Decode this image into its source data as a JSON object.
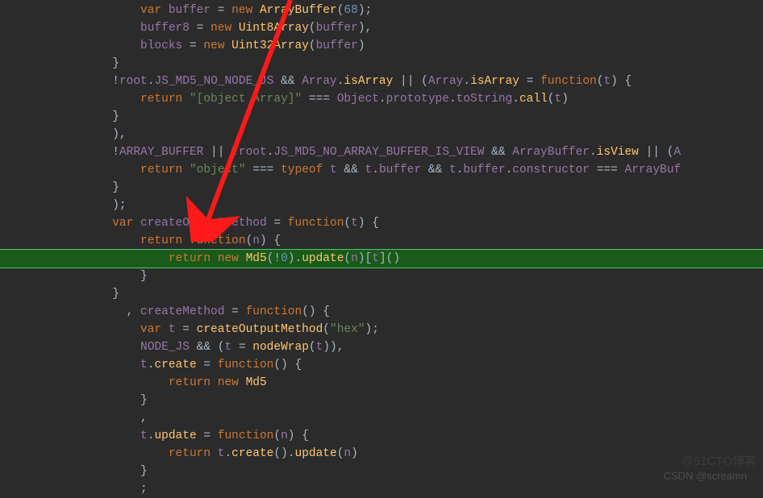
{
  "lines": [
    {
      "indent": "                    ",
      "segs": [
        {
          "c": "kw",
          "t": "var"
        },
        {
          "c": "pl",
          "t": " "
        },
        {
          "c": "id",
          "t": "buffer"
        },
        {
          "c": "pl",
          "t": " = "
        },
        {
          "c": "kw",
          "t": "new"
        },
        {
          "c": "pl",
          "t": " "
        },
        {
          "c": "fn",
          "t": "ArrayBuffer"
        },
        {
          "c": "pl",
          "t": "("
        },
        {
          "c": "num",
          "t": "68"
        },
        {
          "c": "pl",
          "t": ");"
        }
      ],
      "hl": false
    },
    {
      "indent": "                    ",
      "segs": [
        {
          "c": "id",
          "t": "buffer8"
        },
        {
          "c": "pl",
          "t": " = "
        },
        {
          "c": "kw",
          "t": "new"
        },
        {
          "c": "pl",
          "t": " "
        },
        {
          "c": "fn",
          "t": "Uint8Array"
        },
        {
          "c": "pl",
          "t": "("
        },
        {
          "c": "id",
          "t": "buffer"
        },
        {
          "c": "pl",
          "t": "),"
        }
      ],
      "hl": false
    },
    {
      "indent": "                    ",
      "segs": [
        {
          "c": "id",
          "t": "blocks"
        },
        {
          "c": "pl",
          "t": " = "
        },
        {
          "c": "kw",
          "t": "new"
        },
        {
          "c": "pl",
          "t": " "
        },
        {
          "c": "fn",
          "t": "Uint32Array"
        },
        {
          "c": "pl",
          "t": "("
        },
        {
          "c": "id",
          "t": "buffer"
        },
        {
          "c": "pl",
          "t": ")"
        }
      ],
      "hl": false
    },
    {
      "indent": "                ",
      "segs": [
        {
          "c": "pl",
          "t": "}"
        }
      ],
      "hl": false
    },
    {
      "indent": "                ",
      "segs": [
        {
          "c": "pl",
          "t": "!"
        },
        {
          "c": "id",
          "t": "root"
        },
        {
          "c": "pl",
          "t": "."
        },
        {
          "c": "id",
          "t": "JS_MD5_NO_NODE_JS"
        },
        {
          "c": "pl",
          "t": " && "
        },
        {
          "c": "id",
          "t": "Array"
        },
        {
          "c": "pl",
          "t": "."
        },
        {
          "c": "fn",
          "t": "isArray"
        },
        {
          "c": "pl",
          "t": " || ("
        },
        {
          "c": "id",
          "t": "Array"
        },
        {
          "c": "pl",
          "t": "."
        },
        {
          "c": "fn",
          "t": "isArray"
        },
        {
          "c": "pl",
          "t": " = "
        },
        {
          "c": "kw",
          "t": "function"
        },
        {
          "c": "pl",
          "t": "("
        },
        {
          "c": "id",
          "t": "t"
        },
        {
          "c": "pl",
          "t": ") {"
        }
      ],
      "hl": false
    },
    {
      "indent": "                    ",
      "segs": [
        {
          "c": "kw",
          "t": "return"
        },
        {
          "c": "pl",
          "t": " "
        },
        {
          "c": "str",
          "t": "\"[object Array]\""
        },
        {
          "c": "pl",
          "t": " === "
        },
        {
          "c": "id",
          "t": "Object"
        },
        {
          "c": "pl",
          "t": "."
        },
        {
          "c": "id",
          "t": "prototype"
        },
        {
          "c": "pl",
          "t": "."
        },
        {
          "c": "id",
          "t": "toString"
        },
        {
          "c": "pl",
          "t": "."
        },
        {
          "c": "fn",
          "t": "call"
        },
        {
          "c": "pl",
          "t": "("
        },
        {
          "c": "id",
          "t": "t"
        },
        {
          "c": "pl",
          "t": ")"
        }
      ],
      "hl": false
    },
    {
      "indent": "                ",
      "segs": [
        {
          "c": "pl",
          "t": "}"
        }
      ],
      "hl": false
    },
    {
      "indent": "                ",
      "segs": [
        {
          "c": "pl",
          "t": "),"
        }
      ],
      "hl": false
    },
    {
      "indent": "                ",
      "segs": [
        {
          "c": "pl",
          "t": "!"
        },
        {
          "c": "id",
          "t": "ARRAY_BUFFER"
        },
        {
          "c": "pl",
          "t": " || !"
        },
        {
          "c": "id",
          "t": "root"
        },
        {
          "c": "pl",
          "t": "."
        },
        {
          "c": "id",
          "t": "JS_MD5_NO_ARRAY_BUFFER_IS_VIEW"
        },
        {
          "c": "pl",
          "t": " && "
        },
        {
          "c": "id",
          "t": "ArrayBuffer"
        },
        {
          "c": "pl",
          "t": "."
        },
        {
          "c": "fn",
          "t": "isView"
        },
        {
          "c": "pl",
          "t": " || ("
        },
        {
          "c": "id",
          "t": "A"
        }
      ],
      "hl": false
    },
    {
      "indent": "                    ",
      "segs": [
        {
          "c": "kw",
          "t": "return"
        },
        {
          "c": "pl",
          "t": " "
        },
        {
          "c": "str",
          "t": "\"object\""
        },
        {
          "c": "pl",
          "t": " === "
        },
        {
          "c": "kw",
          "t": "typeof"
        },
        {
          "c": "pl",
          "t": " "
        },
        {
          "c": "id",
          "t": "t"
        },
        {
          "c": "pl",
          "t": " && "
        },
        {
          "c": "id",
          "t": "t"
        },
        {
          "c": "pl",
          "t": "."
        },
        {
          "c": "id",
          "t": "buffer"
        },
        {
          "c": "pl",
          "t": " && "
        },
        {
          "c": "id",
          "t": "t"
        },
        {
          "c": "pl",
          "t": "."
        },
        {
          "c": "id",
          "t": "buffer"
        },
        {
          "c": "pl",
          "t": "."
        },
        {
          "c": "id",
          "t": "constructor"
        },
        {
          "c": "pl",
          "t": " === "
        },
        {
          "c": "id",
          "t": "ArrayBuf"
        }
      ],
      "hl": false
    },
    {
      "indent": "                ",
      "segs": [
        {
          "c": "pl",
          "t": "}"
        }
      ],
      "hl": false
    },
    {
      "indent": "                ",
      "segs": [
        {
          "c": "pl",
          "t": ");"
        }
      ],
      "hl": false
    },
    {
      "indent": "                ",
      "segs": [
        {
          "c": "kw",
          "t": "var"
        },
        {
          "c": "pl",
          "t": " "
        },
        {
          "c": "id",
          "t": "createOutputMethod"
        },
        {
          "c": "pl",
          "t": " = "
        },
        {
          "c": "kw",
          "t": "function"
        },
        {
          "c": "pl",
          "t": "("
        },
        {
          "c": "id",
          "t": "t"
        },
        {
          "c": "pl",
          "t": ") {"
        }
      ],
      "hl": false
    },
    {
      "indent": "                    ",
      "segs": [
        {
          "c": "kw",
          "t": "return"
        },
        {
          "c": "pl",
          "t": " "
        },
        {
          "c": "kw",
          "t": "function"
        },
        {
          "c": "pl",
          "t": "("
        },
        {
          "c": "id",
          "t": "n"
        },
        {
          "c": "pl",
          "t": ") {"
        }
      ],
      "hl": false
    },
    {
      "indent": "                        ",
      "segs": [
        {
          "c": "kw",
          "t": "return"
        },
        {
          "c": "pl",
          "t": " "
        },
        {
          "c": "kw",
          "t": "new"
        },
        {
          "c": "pl",
          "t": " "
        },
        {
          "c": "fn",
          "t": "Md5"
        },
        {
          "c": "pl",
          "t": "(!"
        },
        {
          "c": "num",
          "t": "0"
        },
        {
          "c": "pl",
          "t": ")."
        },
        {
          "c": "fn",
          "t": "update"
        },
        {
          "c": "pl",
          "t": "("
        },
        {
          "c": "id",
          "t": "n"
        },
        {
          "c": "pl",
          "t": ")["
        },
        {
          "c": "id",
          "t": "t"
        },
        {
          "c": "pl",
          "t": "]()"
        }
      ],
      "hl": true
    },
    {
      "indent": "                    ",
      "segs": [
        {
          "c": "pl",
          "t": "}"
        }
      ],
      "hl": false
    },
    {
      "indent": "                ",
      "segs": [
        {
          "c": "pl",
          "t": "}"
        }
      ],
      "hl": false
    },
    {
      "indent": "                  ",
      "segs": [
        {
          "c": "pl",
          "t": ", "
        },
        {
          "c": "id",
          "t": "createMethod"
        },
        {
          "c": "pl",
          "t": " = "
        },
        {
          "c": "kw",
          "t": "function"
        },
        {
          "c": "pl",
          "t": "() {"
        }
      ],
      "hl": false
    },
    {
      "indent": "                    ",
      "segs": [
        {
          "c": "kw",
          "t": "var"
        },
        {
          "c": "pl",
          "t": " "
        },
        {
          "c": "id",
          "t": "t"
        },
        {
          "c": "pl",
          "t": " = "
        },
        {
          "c": "fn",
          "t": "createOutputMethod"
        },
        {
          "c": "pl",
          "t": "("
        },
        {
          "c": "str",
          "t": "\"hex\""
        },
        {
          "c": "pl",
          "t": ");"
        }
      ],
      "hl": false
    },
    {
      "indent": "                    ",
      "segs": [
        {
          "c": "id",
          "t": "NODE_JS"
        },
        {
          "c": "pl",
          "t": " && ("
        },
        {
          "c": "id",
          "t": "t"
        },
        {
          "c": "pl",
          "t": " = "
        },
        {
          "c": "fn",
          "t": "nodeWrap"
        },
        {
          "c": "pl",
          "t": "("
        },
        {
          "c": "id",
          "t": "t"
        },
        {
          "c": "pl",
          "t": ")),"
        }
      ],
      "hl": false
    },
    {
      "indent": "                    ",
      "segs": [
        {
          "c": "id",
          "t": "t"
        },
        {
          "c": "pl",
          "t": "."
        },
        {
          "c": "fn",
          "t": "create"
        },
        {
          "c": "pl",
          "t": " = "
        },
        {
          "c": "kw",
          "t": "function"
        },
        {
          "c": "pl",
          "t": "() {"
        }
      ],
      "hl": false
    },
    {
      "indent": "                        ",
      "segs": [
        {
          "c": "kw",
          "t": "return"
        },
        {
          "c": "pl",
          "t": " "
        },
        {
          "c": "kw",
          "t": "new"
        },
        {
          "c": "pl",
          "t": " "
        },
        {
          "c": "fn",
          "t": "Md5"
        }
      ],
      "hl": false
    },
    {
      "indent": "                    ",
      "segs": [
        {
          "c": "pl",
          "t": "}"
        }
      ],
      "hl": false
    },
    {
      "indent": "                    ",
      "segs": [
        {
          "c": "pl",
          "t": ","
        }
      ],
      "hl": false
    },
    {
      "indent": "                    ",
      "segs": [
        {
          "c": "id",
          "t": "t"
        },
        {
          "c": "pl",
          "t": "."
        },
        {
          "c": "fn",
          "t": "update"
        },
        {
          "c": "pl",
          "t": " = "
        },
        {
          "c": "kw",
          "t": "function"
        },
        {
          "c": "pl",
          "t": "("
        },
        {
          "c": "id",
          "t": "n"
        },
        {
          "c": "pl",
          "t": ") {"
        }
      ],
      "hl": false
    },
    {
      "indent": "                        ",
      "segs": [
        {
          "c": "kw",
          "t": "return"
        },
        {
          "c": "pl",
          "t": " "
        },
        {
          "c": "id",
          "t": "t"
        },
        {
          "c": "pl",
          "t": "."
        },
        {
          "c": "fn",
          "t": "create"
        },
        {
          "c": "pl",
          "t": "()."
        },
        {
          "c": "fn",
          "t": "update"
        },
        {
          "c": "pl",
          "t": "("
        },
        {
          "c": "id",
          "t": "n"
        },
        {
          "c": "pl",
          "t": ")"
        }
      ],
      "hl": false
    },
    {
      "indent": "                    ",
      "segs": [
        {
          "c": "pl",
          "t": "}"
        }
      ],
      "hl": false
    },
    {
      "indent": "                    ",
      "segs": [
        {
          "c": "pl",
          "t": ";"
        }
      ],
      "hl": false
    }
  ],
  "watermark1": "CSDN @screamn",
  "watermark2": "@51CTO博客"
}
